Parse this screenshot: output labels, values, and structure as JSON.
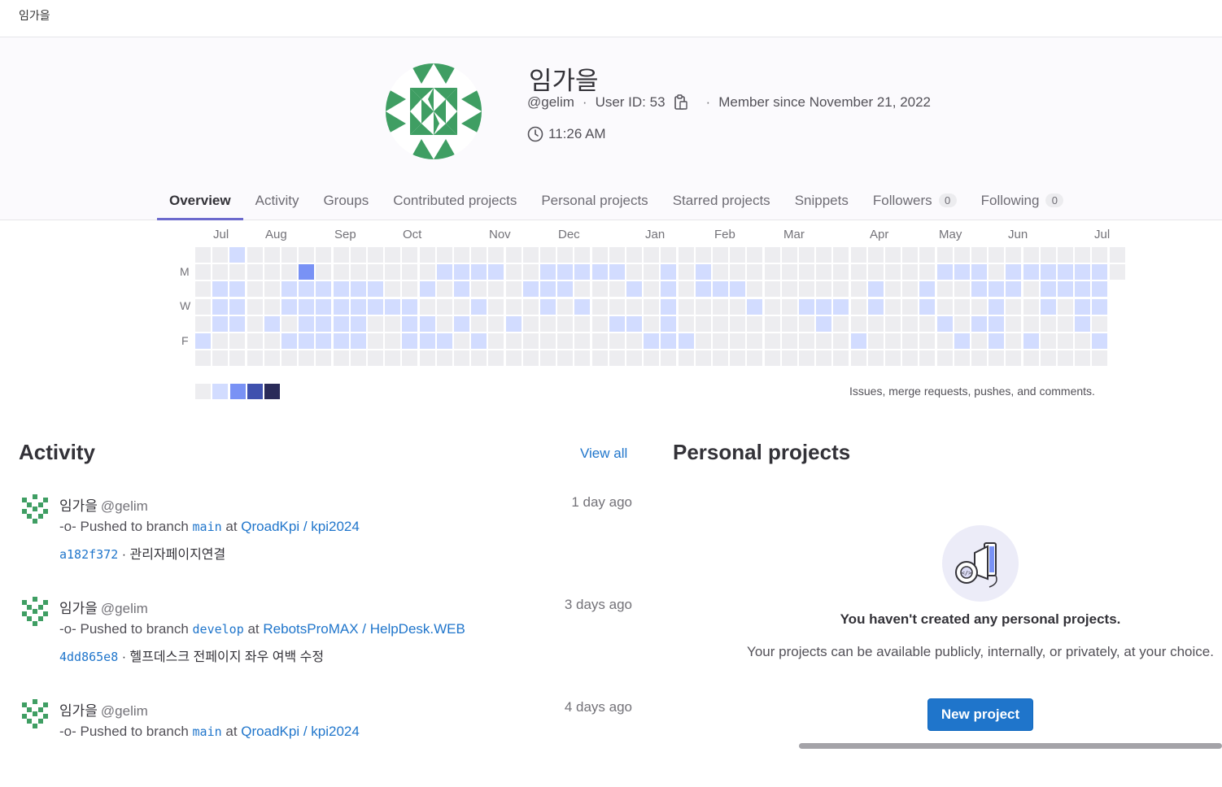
{
  "topbar": {
    "breadcrumb": "임가을"
  },
  "profile": {
    "name": "임가을",
    "username": "@gelim",
    "user_id_text": "User ID: 53",
    "member_since": "Member since November 21, 2022",
    "local_time": "11:26 AM"
  },
  "tabs": [
    {
      "label": "Overview",
      "active": true
    },
    {
      "label": "Activity"
    },
    {
      "label": "Groups"
    },
    {
      "label": "Contributed projects"
    },
    {
      "label": "Personal projects"
    },
    {
      "label": "Starred projects"
    },
    {
      "label": "Snippets"
    },
    {
      "label": "Followers",
      "count": "0"
    },
    {
      "label": "Following",
      "count": "0"
    }
  ],
  "heatmap": {
    "months": [
      "Jul",
      "Aug",
      "Sep",
      "Oct",
      "Nov",
      "Dec",
      "Jan",
      "Feb",
      "Mar",
      "Apr",
      "May",
      "Jun",
      "Jul"
    ],
    "day_labels": [
      "M",
      "W",
      "F"
    ],
    "note": "Issues, merge requests, pushes, and comments.",
    "colors": [
      "#ededf0",
      "#d2dcff",
      "#7992f5",
      "#3f51ae",
      "#2a2b59"
    ]
  },
  "activity": {
    "title": "Activity",
    "view_all": "View all",
    "events": [
      {
        "name": "임가을",
        "handle": "@gelim",
        "time": "1 day ago",
        "action": "Pushed to branch",
        "branch": "main",
        "at": "at",
        "project": "QroadKpi / kpi2024",
        "sha": "a182f372",
        "message": "관리자페이지연결"
      },
      {
        "name": "임가을",
        "handle": "@gelim",
        "time": "3 days ago",
        "action": "Pushed to branch",
        "branch": "develop",
        "at": "at",
        "project": "RebotsProMAX / HelpDesk.WEB",
        "sha": "4dd865e8",
        "message": "헬프데스크 전페이지 좌우 여백 수정"
      },
      {
        "name": "임가을",
        "handle": "@gelim",
        "time": "4 days ago",
        "action": "Pushed to branch",
        "branch": "main",
        "at": "at",
        "project": "QroadKpi / kpi2024",
        "sha": "",
        "message": ""
      }
    ]
  },
  "personal_projects": {
    "title": "Personal projects",
    "empty_title": "You haven't created any personal projects.",
    "empty_desc": "Your projects can be available publicly, internally, or privately, at your choice.",
    "new_button": "New project"
  }
}
